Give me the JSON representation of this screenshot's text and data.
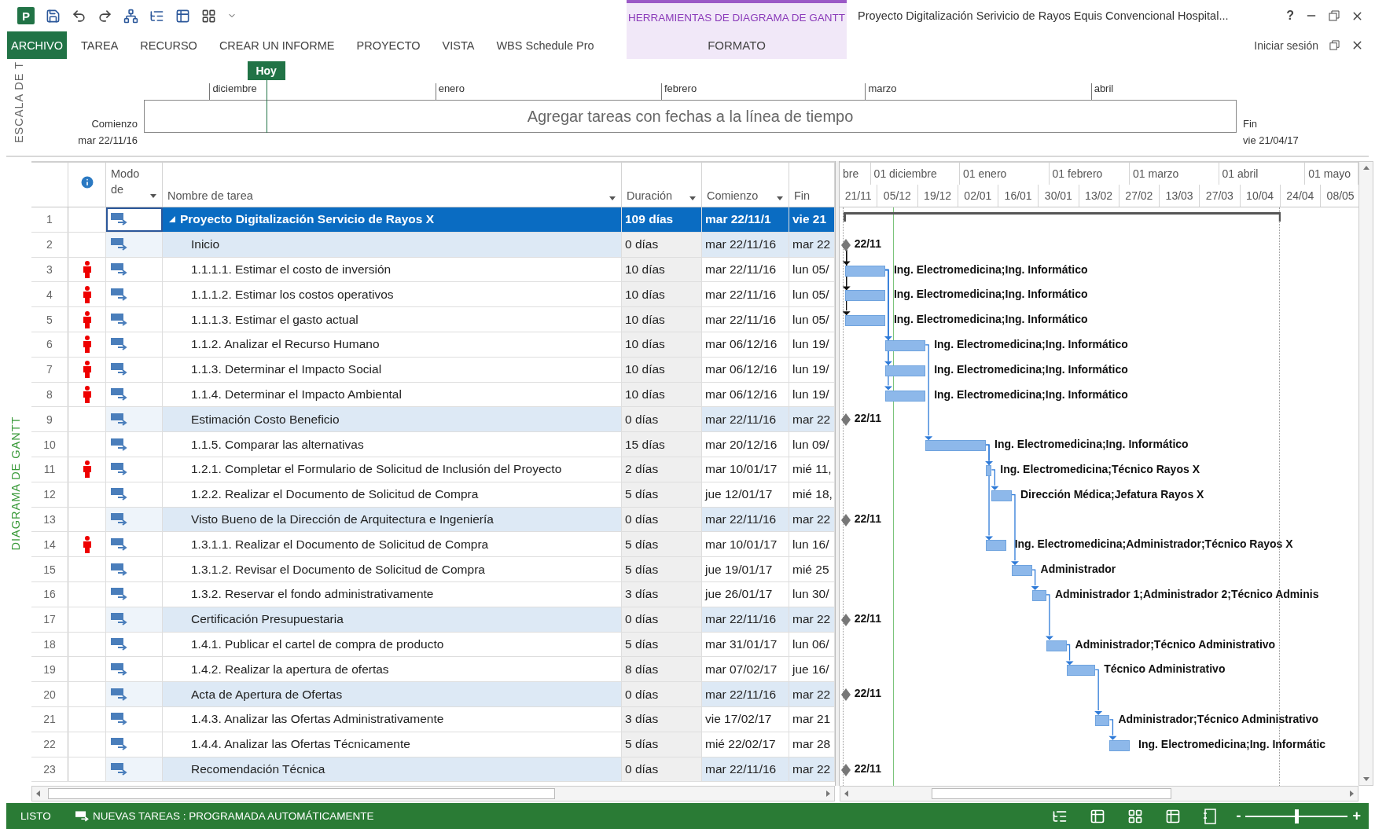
{
  "title_bar": {
    "logo_letter": "P",
    "contextual_group": "HERRAMIENTAS DE DIAGRAMA DE GANTT",
    "title": "Proyecto Digitalización Serivicio de Rayos Equis Convencional Hospital...",
    "help": "?"
  },
  "ribbon_tabs": [
    {
      "label": "ARCHIVO",
      "kind": "file"
    },
    {
      "label": "TAREA",
      "kind": "tab"
    },
    {
      "label": "RECURSO",
      "kind": "tab"
    },
    {
      "label": "CREAR UN INFORME",
      "kind": "tab"
    },
    {
      "label": "PROYECTO",
      "kind": "tab"
    },
    {
      "label": "VISTA",
      "kind": "tab"
    },
    {
      "label": "WBS Schedule Pro",
      "kind": "tab"
    },
    {
      "label": "FORMATO",
      "kind": "contextual"
    }
  ],
  "sign_in": "Iniciar sesión",
  "timeline": {
    "side_label": "ESCALA DE T",
    "today": {
      "label": "Hoy",
      "level": 0.112
    },
    "start_caption": "Comienzo",
    "start_date": "mar 22/11/16",
    "end_caption": "Fin",
    "end_date": "vie 21/04/17",
    "placeholder": "Agregar tareas con fechas a la línea de tiempo",
    "months": [
      "diciembre",
      "enero",
      "febrero",
      "marzo",
      "abril"
    ]
  },
  "view_label": "DIAGRAMA DE GANTT",
  "table": {
    "columns": [
      {
        "label": "Modo de",
        "kind": "mode"
      },
      {
        "label": "Nombre de tarea",
        "kind": "name"
      },
      {
        "label": "Duración",
        "kind": "duration"
      },
      {
        "label": "Comienzo",
        "kind": "start"
      },
      {
        "label": "Fin",
        "kind": "finish"
      }
    ],
    "rows": [
      {
        "id": "1",
        "kind": "summary",
        "selected": true,
        "resource_icon": false,
        "name": "Proyecto Digitalización Servicio de Rayos X",
        "duration": "109 días",
        "start": "mar 22/11/1",
        "finish": "vie 21"
      },
      {
        "id": "2",
        "kind": "milestone",
        "selected": false,
        "resource_icon": false,
        "name": "Inicio",
        "duration": "0 días",
        "start": "mar 22/11/16",
        "finish": "mar 22",
        "bar_label": "22/11"
      },
      {
        "id": "3",
        "kind": "task",
        "selected": false,
        "resource_icon": true,
        "name": "1.1.1.1. Estimar el costo de inversión",
        "duration": "10 días",
        "start": "mar 22/11/16",
        "finish": "lun 05/",
        "bar_label": "Ing. Electromedicina;Ing. Informático",
        "linked": true
      },
      {
        "id": "4",
        "kind": "task",
        "selected": false,
        "resource_icon": true,
        "name": "1.1.1.2. Estimar los costos operativos",
        "duration": "10 días",
        "start": "mar 22/11/16",
        "finish": "lun 05/",
        "bar_label": "Ing. Electromedicina;Ing. Informático",
        "linked": true
      },
      {
        "id": "5",
        "kind": "task",
        "selected": false,
        "resource_icon": true,
        "name": "1.1.1.3. Estimar el gasto actual",
        "duration": "10 días",
        "start": "mar 22/11/16",
        "finish": "lun 05/",
        "bar_label": "Ing. Electromedicina;Ing. Informático",
        "linked": true
      },
      {
        "id": "6",
        "kind": "task",
        "selected": false,
        "resource_icon": true,
        "name": "1.1.2. Analizar el Recurso Humano",
        "duration": "10 días",
        "start": "mar 06/12/16",
        "finish": "lun 19/",
        "bar_label": "Ing. Electromedicina;Ing. Informático",
        "linked": true
      },
      {
        "id": "7",
        "kind": "task",
        "selected": false,
        "resource_icon": true,
        "name": "1.1.3. Determinar  el Impacto Social",
        "duration": "10 días",
        "start": "mar 06/12/16",
        "finish": "lun 19/",
        "bar_label": "Ing. Electromedicina;Ing. Informático",
        "linked": true
      },
      {
        "id": "8",
        "kind": "task",
        "selected": false,
        "resource_icon": true,
        "name": "1.1.4. Determinar el Impacto Ambiental",
        "duration": "10 días",
        "start": "mar 06/12/16",
        "finish": "lun 19/",
        "bar_label": "Ing. Electromedicina;Ing. Informático",
        "linked": true
      },
      {
        "id": "9",
        "kind": "milestone",
        "selected": false,
        "resource_icon": false,
        "name": "Estimación Costo Beneficio",
        "duration": "0 días",
        "start": "mar 22/11/16",
        "finish": "mar 22",
        "bar_label": "22/11"
      },
      {
        "id": "10",
        "kind": "task",
        "selected": false,
        "resource_icon": false,
        "name": "1.1.5. Comparar las alternativas",
        "duration": "15 días",
        "start": "mar 20/12/16",
        "finish": "lun 09/",
        "bar_label": "Ing. Electromedicina;Ing. Informático",
        "linked": true
      },
      {
        "id": "11",
        "kind": "task",
        "selected": false,
        "resource_icon": true,
        "name": "1.2.1. Completar el Formulario de Solicitud de Inclusión del Proyecto",
        "duration": "2 días",
        "start": "mar 10/01/17",
        "finish": "mié 11,",
        "bar_label": "Ing. Electromedicina;Técnico Rayos X",
        "linked": true
      },
      {
        "id": "12",
        "kind": "task",
        "selected": false,
        "resource_icon": false,
        "name": "1.2.2. Realizar el Documento de Solicitud de Compra",
        "duration": "5 días",
        "start": "jue 12/01/17",
        "finish": "mié 18,",
        "bar_label": "Dirección Médica;Jefatura Rayos X",
        "linked": true
      },
      {
        "id": "13",
        "kind": "milestone",
        "selected": false,
        "resource_icon": false,
        "name": "Visto Bueno de la Dirección de Arquitectura e Ingeniería",
        "duration": "0 días",
        "start": "mar 22/11/16",
        "finish": "mar 22",
        "bar_label": "22/11"
      },
      {
        "id": "14",
        "kind": "task",
        "selected": false,
        "resource_icon": true,
        "name": "1.3.1.1. Realizar el Documento de Solicitud de Compra",
        "duration": "5 días",
        "start": "mar 10/01/17",
        "finish": "lun 16/",
        "bar_label": "Ing. Electromedicina;Administrador;Técnico Rayos X",
        "linked": true
      },
      {
        "id": "15",
        "kind": "task",
        "selected": false,
        "resource_icon": false,
        "name": "1.3.1.2. Revisar el Documento de Solicitud de Compra",
        "duration": "5 días",
        "start": "jue 19/01/17",
        "finish": "mié 25",
        "bar_label": "Administrador",
        "linked": true
      },
      {
        "id": "16",
        "kind": "task",
        "selected": false,
        "resource_icon": false,
        "name": "1.3.2. Reservar el fondo administrativamente",
        "duration": "3 días",
        "start": "jue 26/01/17",
        "finish": "lun 30/",
        "bar_label": "Administrador 1;Administrador 2;Técnico Adminis",
        "linked": true
      },
      {
        "id": "17",
        "kind": "milestone",
        "selected": false,
        "resource_icon": false,
        "name": "Certificación Presupuestaria",
        "duration": "0 días",
        "start": "mar 22/11/16",
        "finish": "mar 22",
        "bar_label": "22/11"
      },
      {
        "id": "18",
        "kind": "task",
        "selected": false,
        "resource_icon": false,
        "name": "1.4.1. Publicar el  cartel de compra de producto",
        "duration": "5 días",
        "start": "mar 31/01/17",
        "finish": "lun 06/",
        "bar_label": "Administrador;Técnico Administrativo",
        "linked": true
      },
      {
        "id": "19",
        "kind": "task",
        "selected": false,
        "resource_icon": false,
        "name": "1.4.2. Realizar la apertura de ofertas",
        "duration": "8 días",
        "start": "mar 07/02/17",
        "finish": "jue 16/",
        "bar_label": "Técnico Administrativo",
        "linked": true
      },
      {
        "id": "20",
        "kind": "milestone",
        "selected": false,
        "resource_icon": false,
        "name": "Acta de Apertura de Ofertas",
        "duration": "0 días",
        "start": "mar 22/11/16",
        "finish": "mar 22",
        "bar_label": "22/11"
      },
      {
        "id": "21",
        "kind": "task",
        "selected": false,
        "resource_icon": false,
        "name": "1.4.3. Analizar las Ofertas Administrativamente",
        "duration": "3 días",
        "start": "vie 17/02/17",
        "finish": "mar 21",
        "bar_label": "Administrador;Técnico Administrativo",
        "linked": true
      },
      {
        "id": "22",
        "kind": "task",
        "selected": false,
        "resource_icon": false,
        "name": "1.4.4. Analizar las Ofertas Técnicamente",
        "duration": "5 días",
        "start": "mié 22/02/17",
        "finish": "mar 28",
        "bar_label": "Ing. Electromedicina;Ing. Informátic",
        "linked": true
      },
      {
        "id": "23",
        "kind": "milestone",
        "selected": false,
        "resource_icon": false,
        "name": "Recomendación Técnica",
        "duration": "0 días",
        "start": "mar 22/11/16",
        "finish": "mar 22",
        "bar_label": "22/11"
      }
    ]
  },
  "gantt": {
    "top_tier": [
      "bre",
      "01 diciembre",
      "01 enero",
      "01 febrero",
      "01 marzo",
      "01 abril",
      "01 mayo"
    ],
    "bottom_tier": [
      "21/11",
      "05/12",
      "19/12",
      "02/01",
      "16/01",
      "30/01",
      "13/02",
      "27/02",
      "13/03",
      "27/03",
      "10/04",
      "24/04",
      "08/05"
    ]
  },
  "status_bar": {
    "ready": "LISTO",
    "new_tasks": "NUEVAS TAREAS : PROGRAMADA AUTOMÁTICAMENTE",
    "zoom_out": "-",
    "zoom_in": "+",
    "zoom": {
      "level": 0.5
    }
  }
}
